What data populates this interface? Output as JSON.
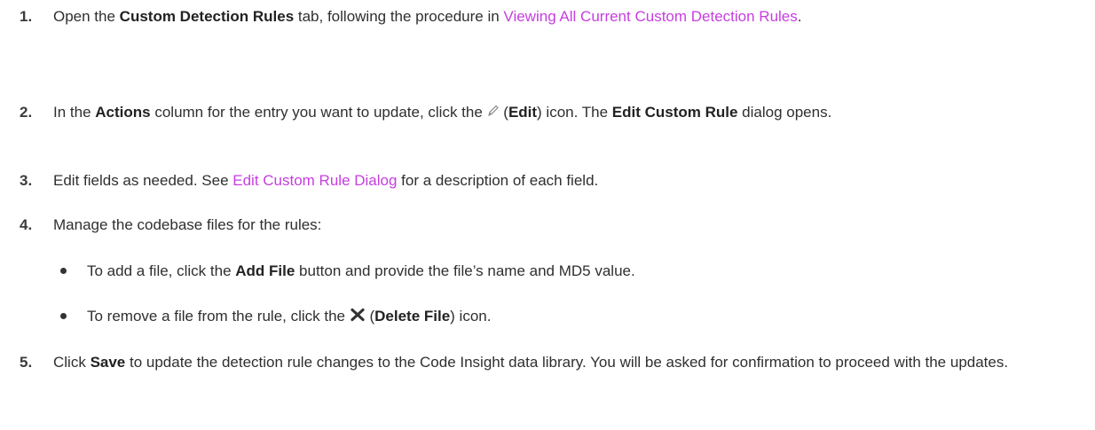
{
  "steps": [
    {
      "num": "1.",
      "t1": "Open the ",
      "b1": "Custom Detection Rules",
      "t2": " tab, following the procedure in ",
      "link": "Viewing All Current Custom Detection Rules",
      "t3": "."
    },
    {
      "num": "2.",
      "t1": "In the ",
      "b1": "Actions",
      "t2": " column for the entry you want to update, click the ",
      "icon": "pencil-icon",
      "t3": " (",
      "b2": "Edit",
      "t4": ") icon. The ",
      "b3": "Edit Custom Rule",
      "t5": " dialog opens."
    },
    {
      "num": "3.",
      "t1": "Edit fields as needed. See ",
      "link": "Edit Custom Rule Dialog",
      "t2": " for a description of each field."
    },
    {
      "num": "4.",
      "t1": "Manage the codebase files for the rules:",
      "bullets": [
        {
          "t1": "To add a file, click the ",
          "b1": "Add File",
          "t2": " button and provide the file’s name and MD5 value."
        },
        {
          "t1": "To remove a file from the rule, click the ",
          "icon": "close-x-icon",
          "t2": " (",
          "b1": "Delete File",
          "t3": ") icon."
        }
      ]
    },
    {
      "num": "5.",
      "t1": "Click ",
      "b1": "Save",
      "t2": " to update the detection rule changes to the Code Insight data library. You will be asked for confirmation to proceed with the updates."
    }
  ],
  "colors": {
    "link": "#c63ee0",
    "text": "#2f2f2f"
  }
}
